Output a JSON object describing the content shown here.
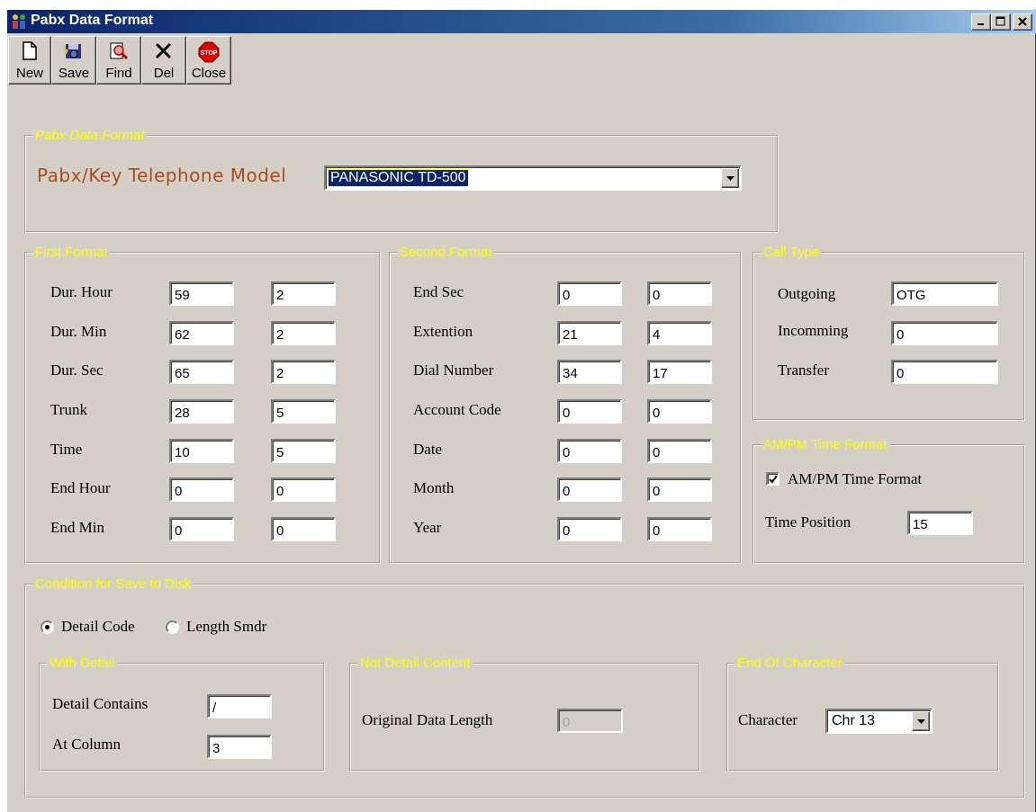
{
  "window": {
    "title": "Pabx Data Format",
    "controls": {
      "minimize": "minimize",
      "maximize": "maximize",
      "close": "close"
    }
  },
  "toolbar": {
    "buttons": [
      {
        "label": "New",
        "icon": "new-document-icon"
      },
      {
        "label": "Save",
        "icon": "save-icon"
      },
      {
        "label": "Find",
        "icon": "find-icon"
      },
      {
        "label": "Del",
        "icon": "delete-x-icon"
      },
      {
        "label": "Close",
        "icon": "stop-sign-icon"
      }
    ]
  },
  "pabx_group": {
    "legend": "Pabx Data Format",
    "model_label": "Pabx/Key Telephone Model",
    "model_value": "PANASONIC TD-500"
  },
  "first_format": {
    "legend": "First Format",
    "rows": [
      {
        "label": "Dur. Hour",
        "pos": "59",
        "len": "2"
      },
      {
        "label": "Dur. Min",
        "pos": "62",
        "len": "2"
      },
      {
        "label": "Dur. Sec",
        "pos": "65",
        "len": "2"
      },
      {
        "label": "Trunk",
        "pos": "28",
        "len": "5"
      },
      {
        "label": "Time",
        "pos": "10",
        "len": "5"
      },
      {
        "label": "End Hour",
        "pos": "0",
        "len": "0"
      },
      {
        "label": "End Min",
        "pos": "0",
        "len": "0"
      }
    ]
  },
  "second_format": {
    "legend": "Second Format",
    "rows": [
      {
        "label": "End Sec",
        "pos": "0",
        "len": "0"
      },
      {
        "label": "Extention",
        "pos": "21",
        "len": "4"
      },
      {
        "label": "Dial Number",
        "pos": "34",
        "len": "17"
      },
      {
        "label": "Account Code",
        "pos": "0",
        "len": "0"
      },
      {
        "label": "Date",
        "pos": "0",
        "len": "0"
      },
      {
        "label": "Month",
        "pos": "0",
        "len": "0"
      },
      {
        "label": "Year",
        "pos": "0",
        "len": "0"
      }
    ]
  },
  "call_type": {
    "legend": "Call Type",
    "rows": [
      {
        "label": "Outgoing",
        "value": "OTG"
      },
      {
        "label": "Incomming",
        "value": "0"
      },
      {
        "label": "Transfer",
        "value": "0"
      }
    ]
  },
  "ampm": {
    "legend": "AM/PM Time Format",
    "checkbox_label": "AM/PM Time Format",
    "checked": true,
    "time_position_label": "Time Position",
    "time_position_value": "15"
  },
  "save_condition": {
    "legend": "Condition for Save to Disk",
    "radio_detail_label": "Detail Code",
    "radio_length_label": "Length Smdr",
    "selected": "Detail Code",
    "with_detail": {
      "legend": "With Detail",
      "detail_contains_label": "Detail Contains",
      "detail_contains_value": "/",
      "at_column_label": "At Column",
      "at_column_value": "3"
    },
    "not_detail": {
      "legend": "Not Detail Content",
      "original_length_label": "Original Data Length",
      "original_length_value": "0"
    },
    "end_char": {
      "legend": "End Of Character",
      "character_label": "Character",
      "character_value": "Chr 13"
    }
  }
}
